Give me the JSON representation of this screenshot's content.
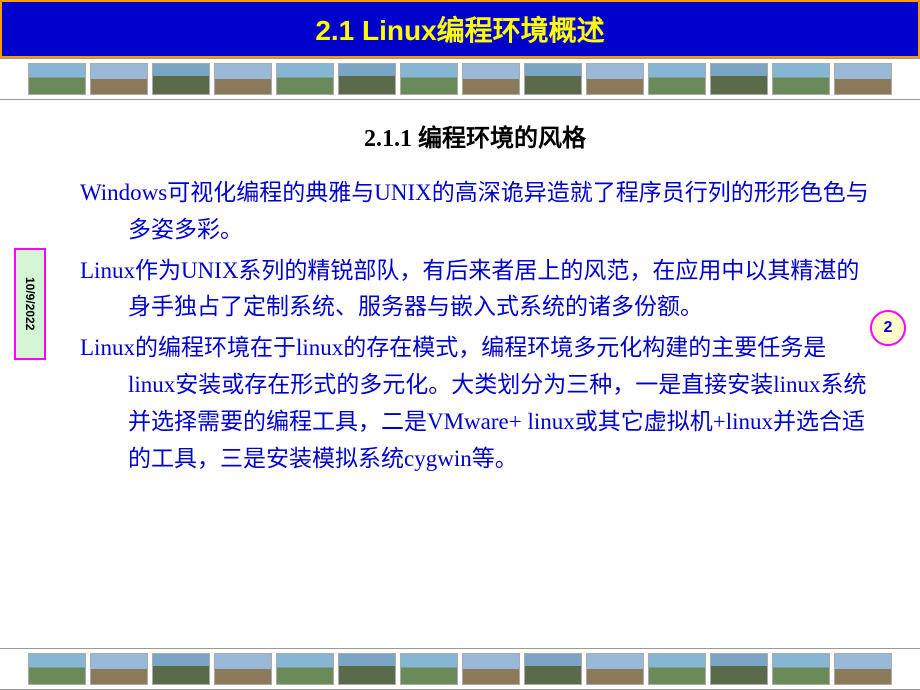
{
  "header": {
    "title": "2.1 Linux编程环境概述"
  },
  "content": {
    "subtitle": "2.1.1 编程环境的风格",
    "paragraphs": [
      "Windows可视化编程的典雅与UNIX的高深诡异造就了程序员行列的形形色色与多姿多彩。",
      "Linux作为UNIX系列的精锐部队，有后来者居上的风范，在应用中以其精湛的身手独占了定制系统、服务器与嵌入式系统的诸多份额。",
      "Linux的编程环境在于linux的存在模式，编程环境多元化构建的主要任务是linux安装或存在形式的多元化。大类划分为三种，一是直接安装linux系统并选择需要的编程工具，二是VMware+ linux或其它虚拟机+linux并选合适的工具，三是安装模拟系统cygwin等。"
    ]
  },
  "meta": {
    "date": "10/9/2022",
    "page_number": "2"
  }
}
